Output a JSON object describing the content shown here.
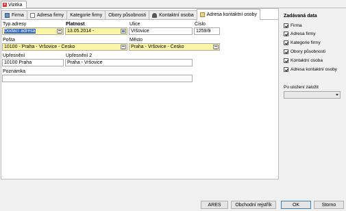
{
  "window": {
    "title": "Vizitka"
  },
  "tabs": [
    {
      "label": "Firma",
      "icon": "firm-icon",
      "active": false
    },
    {
      "label": "Adresa firmy",
      "icon": "page-icon",
      "active": false
    },
    {
      "label": "Kategorie firmy",
      "icon": "",
      "active": false
    },
    {
      "label": "Obory působnosti",
      "icon": "",
      "active": false
    },
    {
      "label": "Kontaktní osoba",
      "icon": "person-icon",
      "active": false
    },
    {
      "label": "Adresa kontaktní osoby",
      "icon": "address-icon",
      "active": true
    }
  ],
  "form": {
    "typ_adresy": {
      "label": "Typ adresy",
      "value": "Dodací adresa"
    },
    "platnost": {
      "label": "Platnost",
      "value": "13.05.2014 -"
    },
    "ulice": {
      "label": "Ulice",
      "value": "Vršovice"
    },
    "cislo": {
      "label": "Číslo",
      "value": "1259/9"
    },
    "posta": {
      "label": "Pošta",
      "value": "10100 - Praha - Vršovice - Česko"
    },
    "mesto": {
      "label": "Město",
      "value": "Praha - Vršovice - Česko"
    },
    "upresneni": {
      "label": "Upřesnění",
      "value": "10100 Praha"
    },
    "upresneni2": {
      "label": "Upřesnění 2",
      "value": "Praha - Vršovice"
    },
    "poznamka": {
      "label": "Poznámka",
      "value": ""
    }
  },
  "right_panel": {
    "title": "Zadávaná data",
    "checkboxes": [
      {
        "label": "Firma",
        "checked": true
      },
      {
        "label": "Adresa firmy",
        "checked": true
      },
      {
        "label": "Kategorie firmy",
        "checked": true
      },
      {
        "label": "Obory působnosti",
        "checked": true
      },
      {
        "label": "Kontaktní osoba",
        "checked": true
      },
      {
        "label": "Adresa kontaktní osoby",
        "checked": true
      }
    ],
    "after_save_label": "Po uložení založit",
    "after_save_value": ""
  },
  "buttons": {
    "ares": "ARES",
    "register": "Obchodní rejstřík",
    "ok": "OK",
    "cancel": "Storno"
  }
}
